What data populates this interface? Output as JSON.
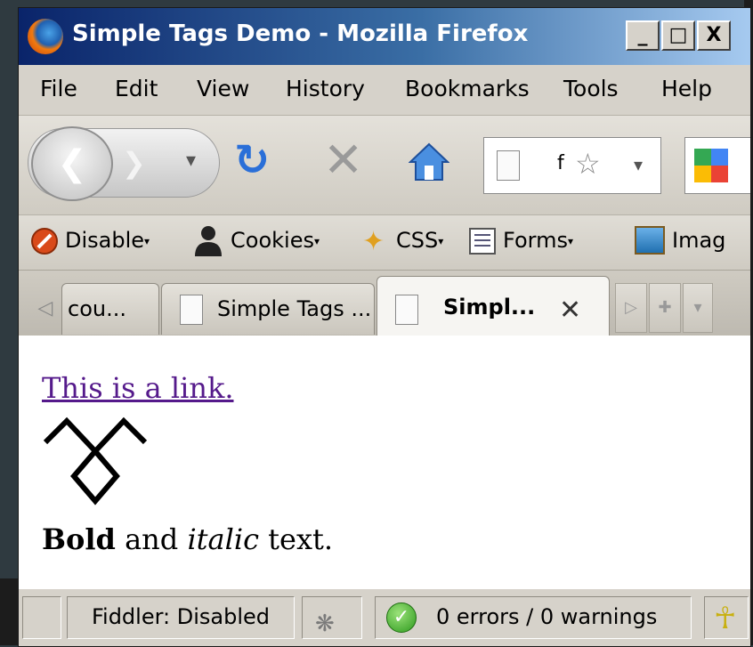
{
  "window": {
    "title": "Simple Tags Demo - Mozilla Firefox",
    "minimize_label": "_",
    "maximize_label": "□",
    "close_label": "X"
  },
  "menu": [
    "File",
    "Edit",
    "View",
    "History",
    "Bookmarks",
    "Tools",
    "Help"
  ],
  "nav": {
    "url_text": "f"
  },
  "webdev_toolbar": {
    "disable_label": "Disable",
    "cookies_label": "Cookies",
    "css_label": "CSS",
    "forms_label": "Forms",
    "images_label": "Imag"
  },
  "tabs": [
    {
      "label": "cou..."
    },
    {
      "label": "Simple Tags ..."
    },
    {
      "label": "Simpl..."
    }
  ],
  "page": {
    "link_text": "This is a link.",
    "bold_text": "Bold",
    "and_text": " and ",
    "italic_text": "italic",
    "text_suffix": " text."
  },
  "status": {
    "fiddler": "Fiddler: Disabled",
    "errors": "0 errors / 0 warnings"
  },
  "colors": {
    "link": "#551a8b",
    "title_bar_start": "#0a246a",
    "title_bar_end": "#a6caf0"
  }
}
